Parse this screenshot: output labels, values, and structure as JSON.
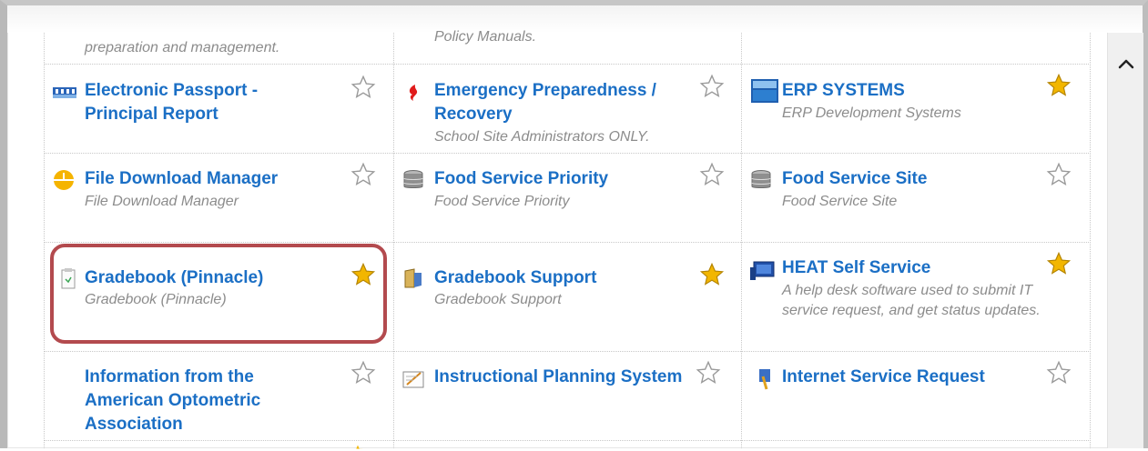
{
  "rows": [
    {
      "cells": [
        {
          "title": "",
          "desc": "preparation and management.",
          "star": "none",
          "icon": "none"
        },
        {
          "title": "",
          "desc": "Policy Manuals.",
          "star": "none",
          "icon": "none"
        },
        {
          "title": "",
          "desc": "",
          "star": "none",
          "icon": "none"
        }
      ]
    },
    {
      "cells": [
        {
          "title": "Electronic Passport - Principal Report",
          "desc": "",
          "star": "empty",
          "icon": "passport-icon"
        },
        {
          "title": "Emergency Preparedness / Recovery",
          "desc": "School Site Administrators ONLY.",
          "star": "empty",
          "icon": "emergency-icon"
        },
        {
          "title": "ERP SYSTEMS",
          "desc": "ERP Development Systems",
          "star": "filled",
          "icon": "erp-icon"
        }
      ]
    },
    {
      "cells": [
        {
          "title": "File Download Manager",
          "desc": "File Download Manager",
          "star": "empty",
          "icon": "file-download-icon"
        },
        {
          "title": "Food Service Priority",
          "desc": "Food Service Priority",
          "star": "empty",
          "icon": "database-icon"
        },
        {
          "title": "Food Service Site",
          "desc": "Food Service Site",
          "star": "empty",
          "icon": "database-icon"
        }
      ]
    },
    {
      "cells": [
        {
          "title": "Gradebook (Pinnacle)",
          "desc": "Gradebook (Pinnacle)",
          "star": "filled",
          "icon": "document-icon"
        },
        {
          "title": "Gradebook Support",
          "desc": "Gradebook Support",
          "star": "filled",
          "icon": "folder-icon"
        },
        {
          "title": "HEAT Self Service",
          "desc": "A help desk software used to submit IT service request, and get status updates.",
          "star": "filled",
          "icon": "heat-icon"
        }
      ]
    },
    {
      "cells": [
        {
          "title": "Information from the American Optometric Association",
          "desc": "",
          "star": "empty",
          "icon": "none"
        },
        {
          "title": "Instructional Planning System",
          "desc": "",
          "star": "empty",
          "icon": "planning-icon"
        },
        {
          "title": "Internet Service Request",
          "desc": "",
          "star": "empty",
          "icon": "service-request-icon"
        }
      ]
    }
  ],
  "colors": {
    "link": "#1b6fc5",
    "desc": "#8c8c8c",
    "star": "#f2b600",
    "highlight": "#b34a4e"
  }
}
